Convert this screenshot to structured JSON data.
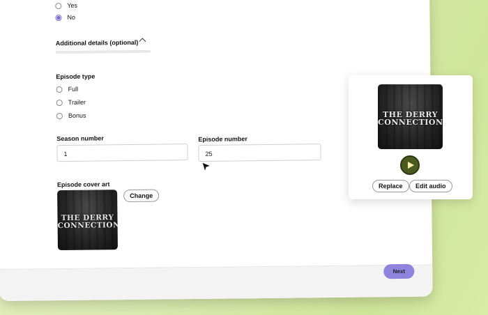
{
  "form": {
    "prev_question": {
      "options": [
        {
          "label": "Yes",
          "checked": false
        },
        {
          "label": "No",
          "checked": true
        }
      ]
    },
    "additional_details": {
      "label": "Additional details (optional)",
      "expanded": true
    },
    "episode_type": {
      "label": "Episode type",
      "options": [
        {
          "label": "Full",
          "checked": false
        },
        {
          "label": "Trailer",
          "checked": false
        },
        {
          "label": "Bonus",
          "checked": false
        }
      ]
    },
    "season_number": {
      "label": "Season number",
      "value": "1"
    },
    "episode_number": {
      "label": "Episode number",
      "value": "25"
    },
    "cover_art": {
      "label": "Episode cover art",
      "change_label": "Change",
      "image_text_line1": "THE DERRY",
      "image_text_line2": "CONNECTION"
    },
    "next_label": "Next"
  },
  "preview_card": {
    "image_text_line1": "THE DERRY",
    "image_text_line2": "CONNECTION",
    "replace_label": "Replace",
    "edit_audio_label": "Edit audio",
    "play_icon": "play-icon"
  },
  "colors": {
    "accent": "#8f83de",
    "play_bg": "#4d5a1e",
    "background": "#dcebb0"
  }
}
